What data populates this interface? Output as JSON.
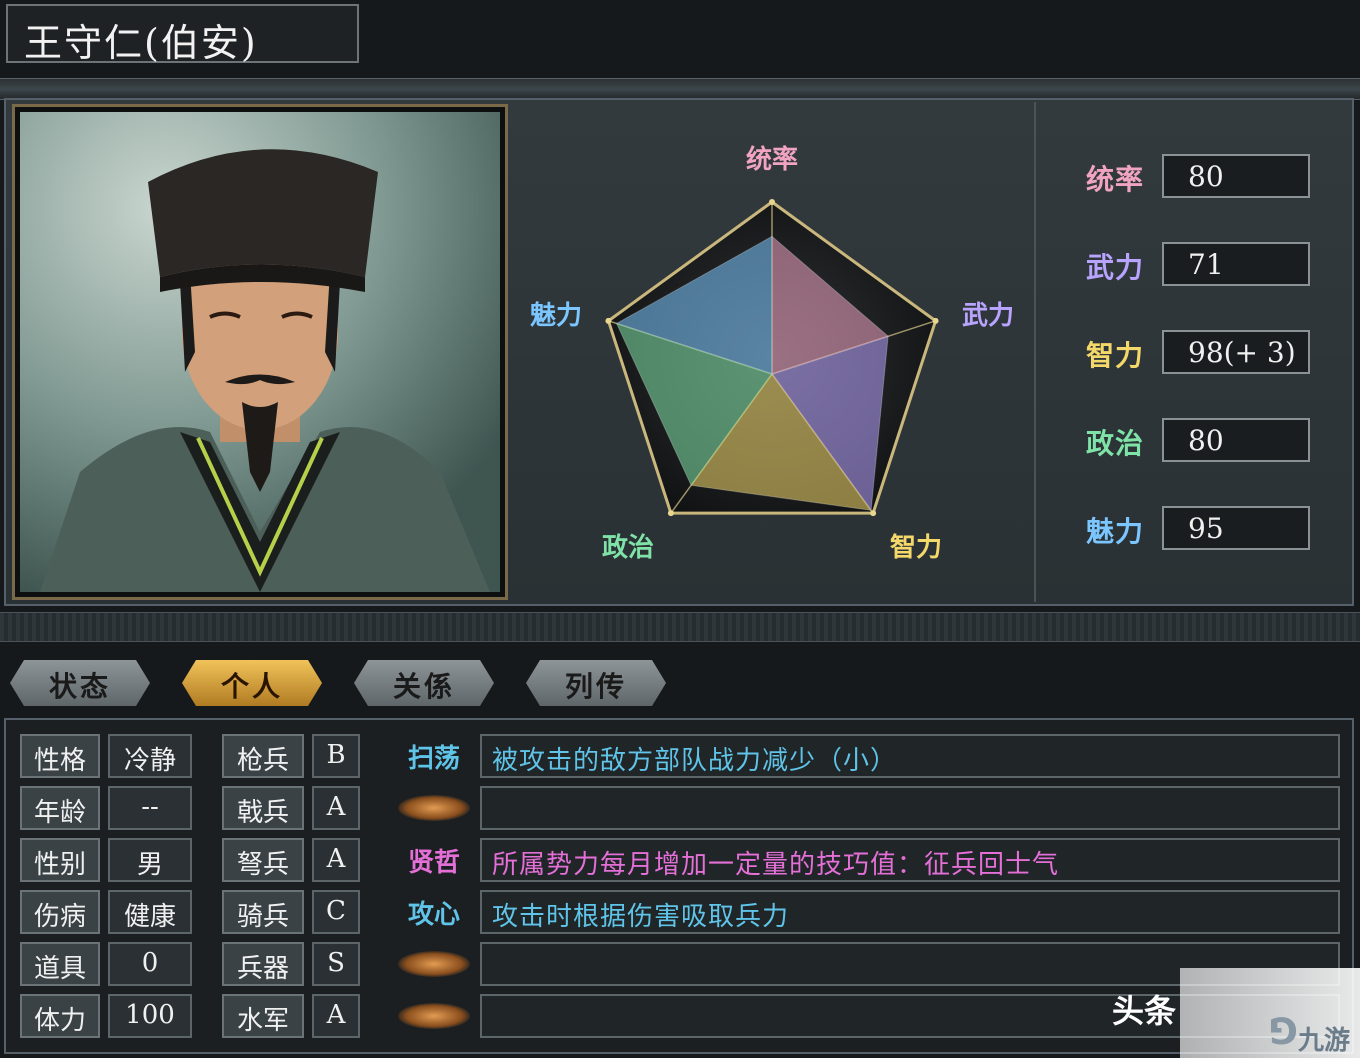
{
  "character": {
    "name": "王守仁(伯安)"
  },
  "radar": {
    "labels": {
      "top": "统率",
      "right": "武力",
      "bottom_right": "智力",
      "bottom_left": "政治",
      "left": "魅力"
    },
    "values": [
      80,
      71,
      98,
      80,
      95
    ],
    "max": 100
  },
  "stats": [
    {
      "label": "统率",
      "value": "80",
      "color": "#f1a4c2"
    },
    {
      "label": "武力",
      "value": "71",
      "color": "#b8a3ff"
    },
    {
      "label": "智力",
      "value": "98(+ 3)",
      "color": "#f4d86a"
    },
    {
      "label": "政治",
      "value": "80",
      "color": "#7fe3a8"
    },
    {
      "label": "魅力",
      "value": "95",
      "color": "#7cc6ff"
    }
  ],
  "tabs": [
    {
      "label": "状态",
      "active": false
    },
    {
      "label": "个人",
      "active": true
    },
    {
      "label": "关係",
      "active": false
    },
    {
      "label": "列传",
      "active": false
    }
  ],
  "personal": [
    {
      "label": "性格",
      "value": "冷静"
    },
    {
      "label": "年龄",
      "value": "--"
    },
    {
      "label": "性别",
      "value": "男"
    },
    {
      "label": "伤病",
      "value": "健康"
    },
    {
      "label": "道具",
      "value": "0"
    },
    {
      "label": "体力",
      "value": "100"
    }
  ],
  "aptitude": [
    {
      "label": "枪兵",
      "grade": "B"
    },
    {
      "label": "戟兵",
      "grade": "A"
    },
    {
      "label": "弩兵",
      "grade": "A"
    },
    {
      "label": "骑兵",
      "grade": "C"
    },
    {
      "label": "兵器",
      "grade": "S"
    },
    {
      "label": "水军",
      "grade": "A"
    }
  ],
  "skills": [
    {
      "name": "扫荡",
      "desc": "被攻击的敌方部队战力减少（小）",
      "name_color": "#5fc4e8",
      "desc_color": "#5fc4e8"
    },
    {
      "name": "",
      "desc": "",
      "name_color": "",
      "desc_color": ""
    },
    {
      "name": "贤哲",
      "desc": "所属势力每月增加一定量的技巧值：征兵回士气",
      "name_color": "#e36fd7",
      "desc_color": "#e36fd7"
    },
    {
      "name": "攻心",
      "desc": "攻击时根据伤害吸取兵力",
      "name_color": "#5fc4e8",
      "desc_color": "#5fc4e8"
    },
    {
      "name": "",
      "desc": "",
      "name_color": "",
      "desc_color": ""
    },
    {
      "name": "",
      "desc": "",
      "name_color": "",
      "desc_color": ""
    }
  ],
  "watermarks": {
    "left": "头条",
    "right": "九游"
  }
}
